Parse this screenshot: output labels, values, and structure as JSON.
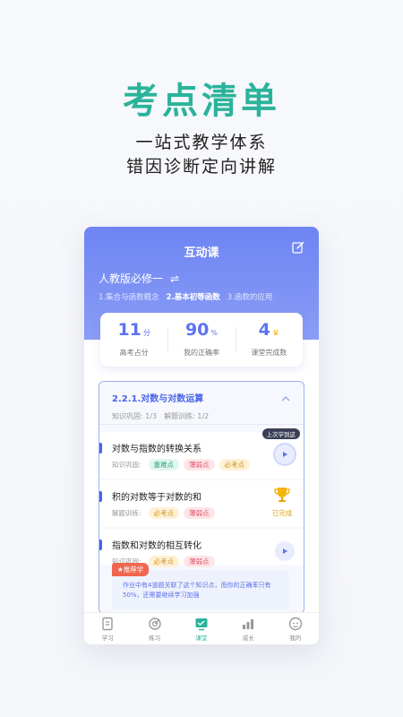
{
  "hero": {
    "title": "考点清单",
    "line1": "一站式教学体系",
    "line2": "错因诊断定向讲解"
  },
  "app": {
    "header_title": "互动课",
    "book": "人教版必修一",
    "swap_icon": "⇌",
    "chapters": [
      {
        "label": "1.集合与函数概念",
        "active": false
      },
      {
        "label": "2.基本初等函数",
        "active": true
      },
      {
        "label": "3.函数的应用",
        "active": false
      }
    ],
    "stats": [
      {
        "value": "11",
        "unit": "分",
        "label": "高考占分"
      },
      {
        "value": "90",
        "unit": "%",
        "label": "我的正确率"
      },
      {
        "value": "4",
        "unit": "",
        "label": "课堂完成数"
      }
    ],
    "lesson": {
      "title": "2.2.1.对数与对数运算",
      "meta1": "知识巩固: 1/3",
      "meta2": "解题训练: 1/2"
    },
    "items": [
      {
        "title": "对数与指数的转换关系",
        "tag_label": "知识巩固:",
        "tags": [
          "重难点",
          "薄弱点",
          "必考点"
        ],
        "tip": "上次学到这"
      },
      {
        "title": "积的对数等于对数的和",
        "tag_label": "解题训练:",
        "tags": [
          "必考点",
          "薄弱点"
        ],
        "done": "已完成"
      },
      {
        "title": "指数和对数的相互转化",
        "tag_label": "知识巩固:",
        "tags": [
          "必考点",
          "薄弱点"
        ]
      }
    ],
    "recommend": {
      "badge": "★推荐学",
      "text": "作业中有4道题关联了这个知识点，而你的正确率只有50%，还需要继续学习加强"
    },
    "tabs": [
      {
        "label": "学习",
        "icon": "book-icon"
      },
      {
        "label": "练习",
        "icon": "target-icon"
      },
      {
        "label": "课堂",
        "icon": "classroom-icon",
        "active": true
      },
      {
        "label": "成长",
        "icon": "growth-chart-icon"
      },
      {
        "label": "我的",
        "icon": "profile-face-icon"
      }
    ],
    "colors": {
      "accent": "#2bb39b",
      "primary": "#5c74f0",
      "header": "#7b8ef4"
    }
  }
}
